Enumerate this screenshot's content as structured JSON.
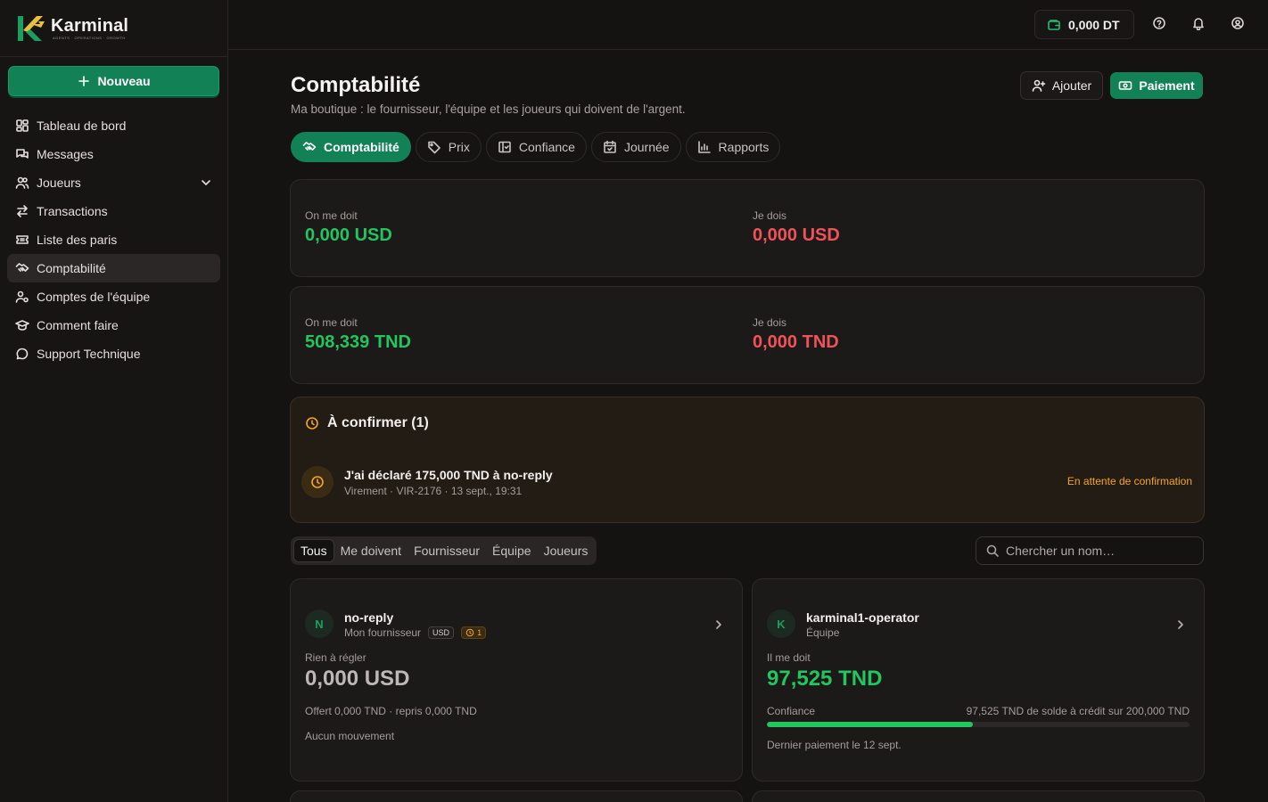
{
  "brand": {
    "name": "Karminal",
    "tagline": "AGENTS · OPERATIONS · GROWTH"
  },
  "sidebar": {
    "new_label": "Nouveau",
    "items": [
      {
        "label": "Tableau de bord",
        "icon": "dashboard-icon"
      },
      {
        "label": "Messages",
        "icon": "messages-icon"
      },
      {
        "label": "Joueurs",
        "icon": "users-icon"
      },
      {
        "label": "Transactions",
        "icon": "transactions-icon"
      },
      {
        "label": "Liste des paris",
        "icon": "ticket-icon"
      },
      {
        "label": "Comptabilité",
        "icon": "handshake-icon"
      },
      {
        "label": "Comptes de l'équipe",
        "icon": "team-icon"
      },
      {
        "label": "Comment faire",
        "icon": "graduation-icon"
      },
      {
        "label": "Support Technique",
        "icon": "chat-icon"
      }
    ]
  },
  "topbar": {
    "wallet": "0,000 DT"
  },
  "page": {
    "title": "Comptabilité",
    "subtitle": "Ma boutique : le fournisseur, l'équipe et les joueurs qui doivent de l'argent.",
    "add_label": "Ajouter",
    "payment_label": "Paiement"
  },
  "tabs": [
    "Comptabilité",
    "Prix",
    "Confiance",
    "Journée",
    "Rapports"
  ],
  "balances": [
    {
      "owed_label": "On me doit",
      "owed": "0,000 USD",
      "owe_label": "Je dois",
      "owe": "0,000 USD"
    },
    {
      "owed_label": "On me doit",
      "owed": "508,339 TND",
      "owe_label": "Je dois",
      "owe": "0,000 TND"
    }
  ],
  "pending": {
    "title": "À confirmer (1)",
    "main": "J'ai déclaré 175,000 TND à no-reply",
    "sub": "Virement · VIR-2176 · 13 sept., 19:31",
    "status": "En attente de confirmation"
  },
  "filters": [
    "Tous",
    "Me doivent",
    "Fournisseur",
    "Équipe",
    "Joueurs"
  ],
  "search": {
    "placeholder": "Chercher un nom…"
  },
  "accounts": [
    {
      "initial": "N",
      "name": "no-reply",
      "role": "Mon fournisseur",
      "currency": "USD",
      "pending_count": "1",
      "label": "Rien à régler",
      "amount": "0,000 USD",
      "line1": "Offert 0,000 TND · repris 0,000 TND",
      "line2": "Aucun mouvement"
    },
    {
      "initial": "K",
      "name": "karminal1-operator",
      "role": "Équipe",
      "label": "Il me doit",
      "amount": "97,525 TND",
      "trust_label": "Confiance",
      "trust_detail": "97,525 TND de solde à crédit sur 200,000 TND",
      "trust_fraction": 0.4876,
      "line2": "Dernier paiement le 12 sept."
    }
  ],
  "colors": {
    "accent": "#128156",
    "positive": "#22c55e",
    "negative": "#f0525a",
    "warning": "#f5a524"
  }
}
